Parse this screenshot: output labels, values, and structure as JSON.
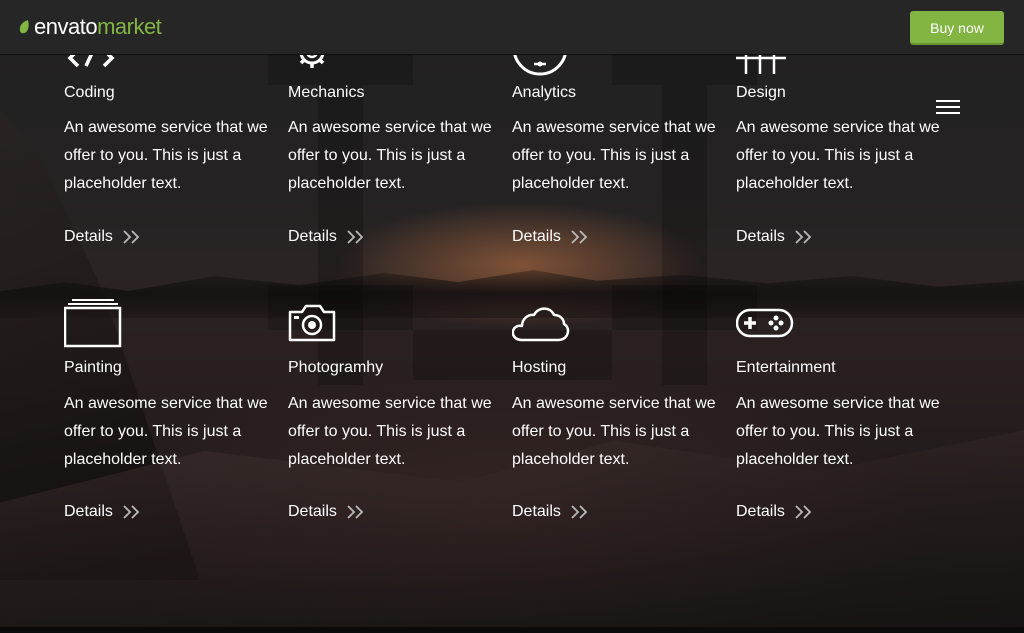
{
  "header": {
    "logo_main": "envato",
    "logo_accent": "market",
    "buy_label": "Buy now"
  },
  "colors": {
    "accent": "#82b541",
    "topbar": "#262626"
  },
  "menu": {
    "icon": "hamburger-icon"
  },
  "services": [
    {
      "title": "Coding",
      "icon": "code-icon",
      "desc": "An awesome service that we offer to you. This is just a placeholder text.",
      "details": "Details"
    },
    {
      "title": "Mechanics",
      "icon": "gear-icon",
      "desc": "An awesome service that we offer to you. This is just a placeholder text.",
      "details": "Details"
    },
    {
      "title": "Analytics",
      "icon": "dashboard-icon",
      "desc": "An awesome service that we offer to you. This is just a placeholder text.",
      "details": "Details"
    },
    {
      "title": "Design",
      "icon": "grid-icon",
      "desc": "An awesome service that we offer to you. This is just a placeholder text.",
      "details": "Details"
    },
    {
      "title": "Painting",
      "icon": "canvas-icon",
      "desc": "An awesome service that we offer to you. This is just a placeholder text.",
      "details": "Details"
    },
    {
      "title": "Photogramhy",
      "icon": "camera-icon",
      "desc": "An awesome service that we offer to you. This is just a placeholder text.",
      "details": "Details"
    },
    {
      "title": "Hosting",
      "icon": "cloud-icon",
      "desc": "An awesome service that we offer to you. This is just a placeholder text.",
      "details": "Details"
    },
    {
      "title": "Entertainment",
      "icon": "gamepad-icon",
      "desc": "An awesome service that we offer to you. This is just a placeholder text.",
      "details": "Details"
    }
  ]
}
